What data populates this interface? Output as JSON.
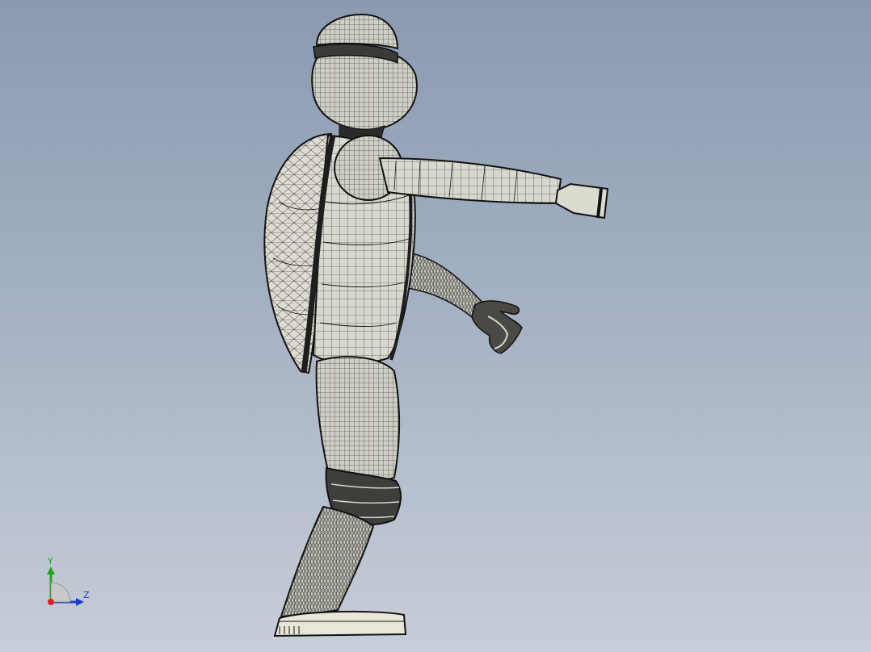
{
  "colors": {
    "background_top": "#8a9ab0",
    "background_bottom": "#c7cdd8",
    "model_fill": "#d9d8cf",
    "mesh_line": "#1a1a1a",
    "axis_x": "#e02020",
    "axis_y": "#1fa81f",
    "axis_z": "#1a3fd1"
  },
  "triad": {
    "y_label": "Y",
    "z_label": "Z"
  },
  "model": {
    "icon": "wireframe-turtle-figure"
  }
}
